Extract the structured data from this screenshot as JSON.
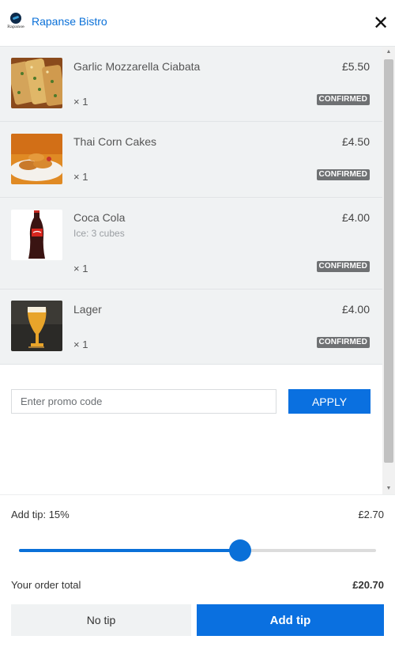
{
  "header": {
    "logo_text": "Rapanse",
    "brand": "Rapanse Bistro",
    "close_glyph": "✕"
  },
  "items": [
    {
      "name": "Garlic Mozzarella Ciabata",
      "note": "",
      "price": "£5.50",
      "qty": "× 1",
      "status": "CONFIRMED"
    },
    {
      "name": "Thai Corn Cakes",
      "note": "",
      "price": "£4.50",
      "qty": "× 1",
      "status": "CONFIRMED"
    },
    {
      "name": "Coca Cola",
      "note": "Ice: 3 cubes",
      "price": "£4.00",
      "qty": "× 1",
      "status": "CONFIRMED"
    },
    {
      "name": "Lager",
      "note": "",
      "price": "£4.00",
      "qty": "× 1",
      "status": "CONFIRMED"
    }
  ],
  "promo": {
    "placeholder": "Enter promo code",
    "value": "",
    "apply_label": "APPLY"
  },
  "tip": {
    "label": "Add tip: 15%",
    "amount": "£2.70",
    "slider_fraction": 0.62
  },
  "total": {
    "label": "Your order total",
    "value": "£20.70"
  },
  "buttons": {
    "no_tip": "No tip",
    "add_tip": "Add tip"
  },
  "colors": {
    "accent": "#0a70e0",
    "badge": "#6f7173",
    "item_bg": "#f0f2f3"
  }
}
